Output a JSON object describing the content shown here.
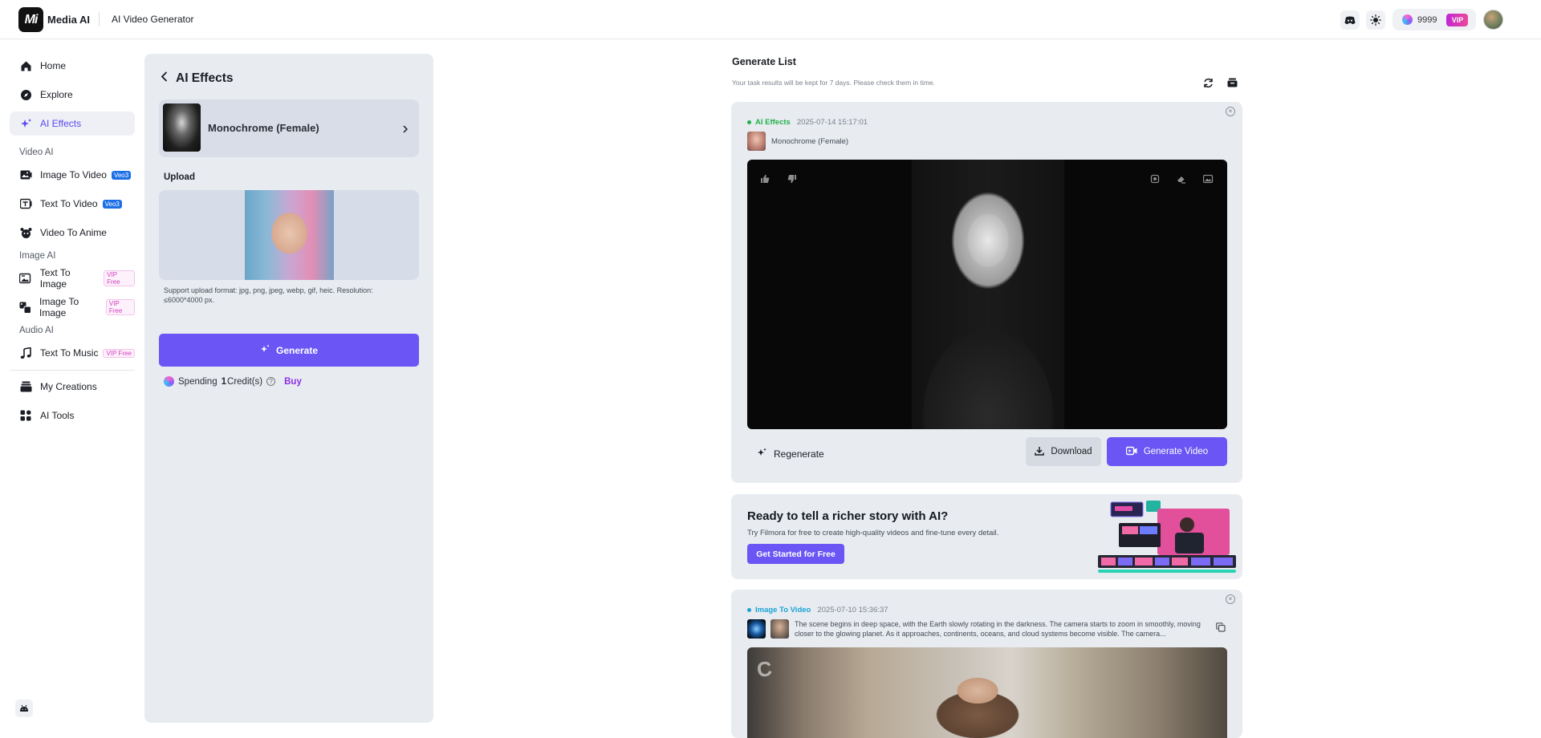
{
  "topbar": {
    "logo_text": "Mi",
    "brand": "Media AI",
    "app_title": "AI Video Generator",
    "icons": [
      "discord-icon",
      "theme-toggle-icon"
    ],
    "credits": "9999",
    "vip_label": "VIP"
  },
  "sidebar": {
    "main_items": [
      {
        "label": "Home",
        "icon": "home-icon"
      },
      {
        "label": "Explore",
        "icon": "compass-icon"
      },
      {
        "label": "AI Effects",
        "icon": "sparkle-icon",
        "active": true
      }
    ],
    "video_section": "Video AI",
    "video_items": [
      {
        "label": "Image To Video",
        "badge": "Veo3"
      },
      {
        "label": "Text To Video",
        "badge": "Veo3"
      },
      {
        "label": "Video To Anime",
        "badge": ""
      }
    ],
    "image_section": "Image AI",
    "image_items": [
      {
        "label": "Text To Image",
        "badge": "VIP Free"
      },
      {
        "label": "Image To Image",
        "badge": "VIP Free"
      }
    ],
    "audio_section": "Audio AI",
    "audio_items": [
      {
        "label": "Text To Music",
        "badge": "VIP Free"
      }
    ],
    "bottom_items": [
      {
        "label": "My Creations",
        "icon": "creations-icon"
      },
      {
        "label": "AI Tools",
        "icon": "tools-icon"
      }
    ]
  },
  "effects_panel": {
    "title": "AI Effects",
    "selected_effect": "Monochrome (Female)",
    "upload_label": "Upload",
    "upload_hint": "Support upload format: jpg, png, jpeg, webp, gif, heic. Resolution: ≤6000*4000 px.",
    "generate_label": "Generate",
    "spending_prefix": "Spending",
    "spending_amount": "1",
    "spending_suffix": "Credit(s)",
    "buy_label": "Buy"
  },
  "generate_list": {
    "title": "Generate List",
    "subtitle": "Your task results will be kept for 7 days. Please check them in time.",
    "task1": {
      "type": "AI Effects",
      "type_color": "#22b14c",
      "date": "2025-07-14 15:17:01",
      "effect_name": "Monochrome (Female)",
      "regenerate_label": "Regenerate",
      "download_label": "Download",
      "generate_video_label": "Generate Video"
    },
    "promo": {
      "title": "Ready to tell a richer story with AI?",
      "subtitle": "Try Filmora for free to create high-quality videos and fine-tune every detail.",
      "button": "Get Started for Free"
    },
    "task2": {
      "type": "Image To Video",
      "type_color": "#1aa3d6",
      "date": "2025-07-10 15:36:37",
      "prompt": "The scene begins in deep space, with the Earth slowly rotating in the darkness. The camera starts to zoom in smoothly, moving closer to the glowing planet. As it approaches, continents, oceans, and cloud systems become visible. The camera..."
    }
  },
  "colors": {
    "accent": "#6b55f4",
    "panel_bg": "#e8ebf0"
  }
}
